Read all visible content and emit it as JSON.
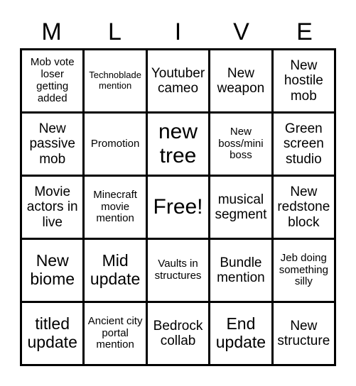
{
  "card": {
    "header_letters": [
      "M",
      "L",
      "I",
      "V",
      "E"
    ],
    "rows": [
      [
        {
          "text": "Mob vote loser getting added",
          "size": "sm"
        },
        {
          "text": "Technoblade mention",
          "size": "xs"
        },
        {
          "text": "Youtuber cameo",
          "size": "md"
        },
        {
          "text": "New weapon",
          "size": "md"
        },
        {
          "text": "New hostile mob",
          "size": "md"
        }
      ],
      [
        {
          "text": "New passive mob",
          "size": "md"
        },
        {
          "text": "Promotion",
          "size": "sm"
        },
        {
          "text": "new tree",
          "size": "xl"
        },
        {
          "text": "New boss/mini boss",
          "size": "sm"
        },
        {
          "text": "Green screen studio",
          "size": "md"
        }
      ],
      [
        {
          "text": "Movie actors in live",
          "size": "md"
        },
        {
          "text": "Minecraft movie mention",
          "size": "sm"
        },
        {
          "text": "Free!",
          "size": "xl"
        },
        {
          "text": "musical segment",
          "size": "md"
        },
        {
          "text": "New redstone block",
          "size": "md"
        }
      ],
      [
        {
          "text": "New biome",
          "size": "lg"
        },
        {
          "text": "Mid update",
          "size": "lg"
        },
        {
          "text": "Vaults in structures",
          "size": "sm"
        },
        {
          "text": "Bundle mention",
          "size": "md"
        },
        {
          "text": "Jeb doing something silly",
          "size": "sm"
        }
      ],
      [
        {
          "text": "titled update",
          "size": "lg"
        },
        {
          "text": "Ancient city portal mention",
          "size": "sm"
        },
        {
          "text": "Bedrock collab",
          "size": "md"
        },
        {
          "text": "End update",
          "size": "lg"
        },
        {
          "text": "New structure",
          "size": "md"
        }
      ]
    ]
  },
  "colors": {
    "background": "#ffffff",
    "text": "#000000",
    "border": "#000000"
  }
}
